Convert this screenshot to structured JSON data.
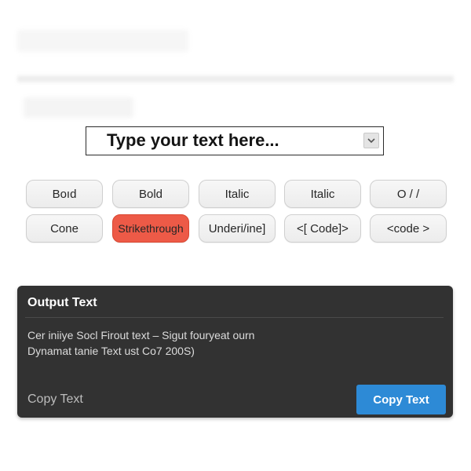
{
  "input": {
    "placeholder": "Type your text here...",
    "value": "",
    "dropdown_icon": "chevron-down-icon"
  },
  "format_buttons": {
    "row1": [
      "Boıd",
      "Bold",
      "Italic",
      "Italic",
      "O / /"
    ],
    "row2": [
      "Cone",
      "Strikethrough",
      "Underi/ine]",
      "<[   Code]>",
      "<code >"
    ],
    "active": "Strikethrough"
  },
  "output": {
    "title": "Output Text",
    "lines": [
      "Cer iniiye Socl  Firout text – Sigut fouryeat ourn",
      "Dynamat tanie Text ust Co7 200S)"
    ],
    "copy_label_secondary": "Copy Text",
    "copy_label_primary": "Copy Text"
  },
  "colors": {
    "active_button": "#ed5a47",
    "panel_bg": "#323232",
    "primary_button": "#2d8ad6"
  }
}
